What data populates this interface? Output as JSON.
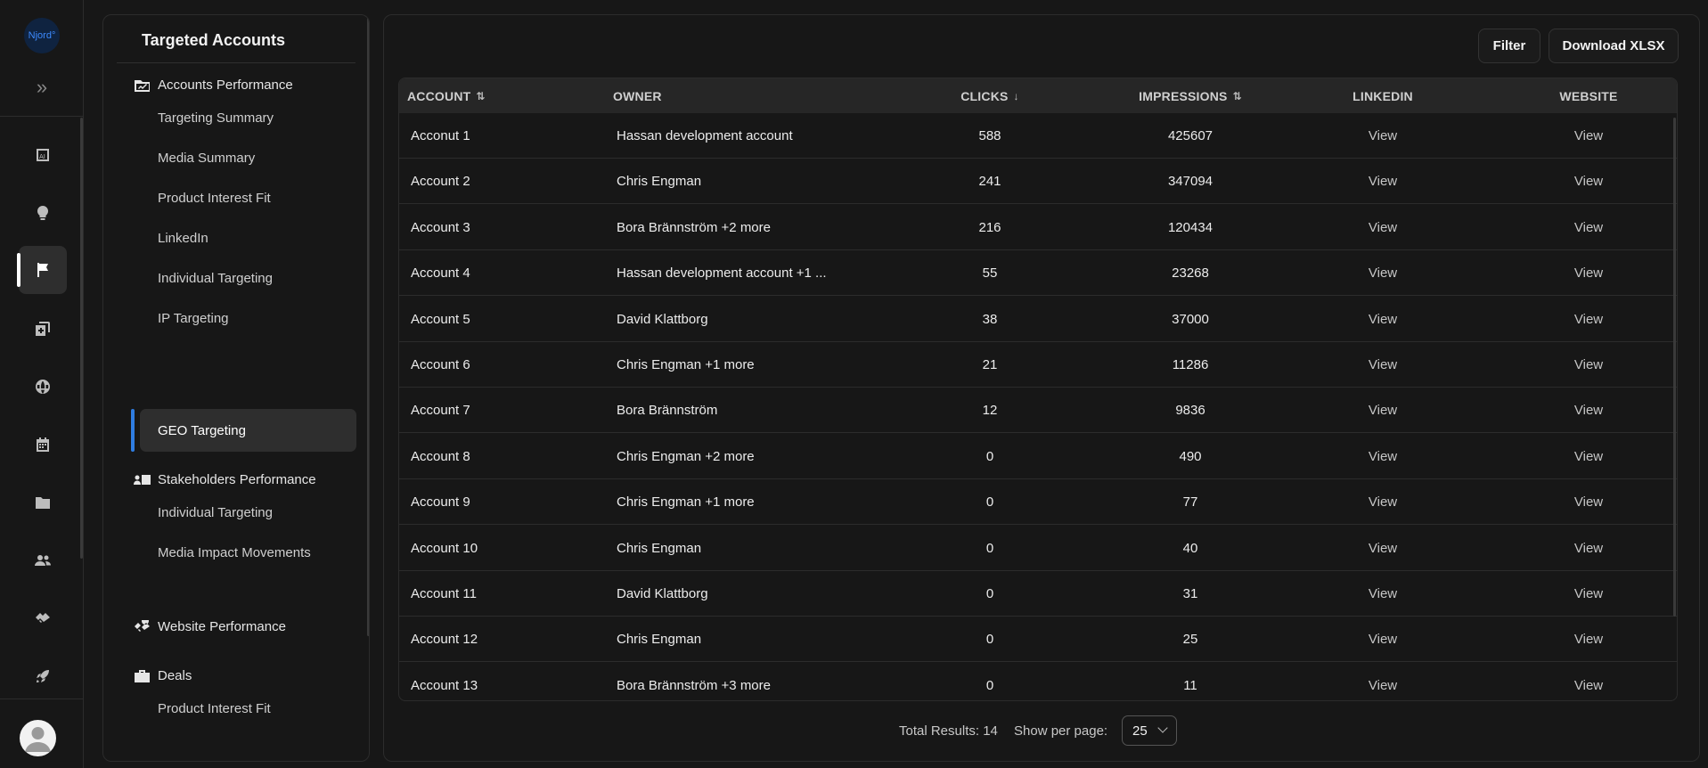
{
  "rail": {
    "logo_text": "Njord°",
    "items": [
      {
        "name": "ai-report-icon",
        "active": false
      },
      {
        "name": "lightbulb-icon",
        "active": false
      },
      {
        "name": "flag-icon",
        "active": true
      },
      {
        "name": "add-copy-icon",
        "active": false
      },
      {
        "name": "globe-icon",
        "active": false
      },
      {
        "name": "calendar-icon",
        "active": false
      },
      {
        "name": "folder-icon",
        "active": false
      },
      {
        "name": "users-icon",
        "active": false
      },
      {
        "name": "handshake-icon",
        "active": false
      },
      {
        "name": "rocket-icon",
        "active": false
      }
    ]
  },
  "subnav": {
    "title": "Targeted Accounts",
    "groups": {
      "accounts_performance": "Accounts Performance",
      "stakeholders_performance": "Stakeholders Performance",
      "website_performance": "Website Performance",
      "deals": "Deals"
    },
    "items": {
      "targeting_summary": "Targeting Summary",
      "media_summary": "Media Summary",
      "product_interest_fit": "Product Interest Fit",
      "linkedin": "LinkedIn",
      "individual_targeting": "Individual Targeting",
      "ip_targeting": "IP Targeting",
      "geo_targeting": "GEO Targeting",
      "individual_targeting_2": "Individual Targeting",
      "media_impact_movements": "Media Impact Movements",
      "product_interest_fit_2": "Product Interest Fit"
    },
    "active_item": "GEO Targeting"
  },
  "toolbar": {
    "filter_label": "Filter",
    "download_label": "Download XLSX"
  },
  "table": {
    "columns": {
      "account": "ACCOUNT",
      "owner": "OWNER",
      "clicks": "CLICKS",
      "impressions": "IMPRESSIONS",
      "linkedin": "LINKEDIN",
      "website": "WEBSITE"
    },
    "sort_icons": {
      "account": "⇅",
      "clicks": "↓",
      "impressions": "⇅"
    },
    "rows": [
      {
        "account": "Acconut 1",
        "owner": "Hassan development account",
        "clicks": "588",
        "impressions": "425607",
        "linkedin": "View",
        "website": "View"
      },
      {
        "account": "Account 2",
        "owner": "Chris Engman",
        "clicks": "241",
        "impressions": "347094",
        "linkedin": "View",
        "website": "View"
      },
      {
        "account": "Account 3",
        "owner": "Bora Brännström +2 more",
        "clicks": "216",
        "impressions": "120434",
        "linkedin": "View",
        "website": "View"
      },
      {
        "account": "Account 4",
        "owner": "Hassan development account +1 ...",
        "clicks": "55",
        "impressions": "23268",
        "linkedin": "View",
        "website": "View"
      },
      {
        "account": "Account 5",
        "owner": "David Klattborg",
        "clicks": "38",
        "impressions": "37000",
        "linkedin": "View",
        "website": "View"
      },
      {
        "account": "Account 6",
        "owner": "Chris Engman +1 more",
        "clicks": "21",
        "impressions": "11286",
        "linkedin": "View",
        "website": "View"
      },
      {
        "account": "Account 7",
        "owner": "Bora Brännström",
        "clicks": "12",
        "impressions": "9836",
        "linkedin": "View",
        "website": "View"
      },
      {
        "account": "Account 8",
        "owner": "Chris Engman +2 more",
        "clicks": "0",
        "impressions": "490",
        "linkedin": "View",
        "website": "View"
      },
      {
        "account": "Account 9",
        "owner": "Chris Engman +1 more",
        "clicks": "0",
        "impressions": "77",
        "linkedin": "View",
        "website": "View"
      },
      {
        "account": "Account 10",
        "owner": "Chris Engman",
        "clicks": "0",
        "impressions": "40",
        "linkedin": "View",
        "website": "View"
      },
      {
        "account": "Account 11",
        "owner": "David Klattborg",
        "clicks": "0",
        "impressions": "31",
        "linkedin": "View",
        "website": "View"
      },
      {
        "account": "Account 12",
        "owner": "Chris Engman",
        "clicks": "0",
        "impressions": "25",
        "linkedin": "View",
        "website": "View"
      },
      {
        "account": "Account 13",
        "owner": "Bora Brännström +3 more",
        "clicks": "0",
        "impressions": "11",
        "linkedin": "View",
        "website": "View"
      }
    ]
  },
  "footer": {
    "total_results": "Total Results: 14",
    "per_page_label": "Show per page:",
    "per_page_value": "25"
  }
}
